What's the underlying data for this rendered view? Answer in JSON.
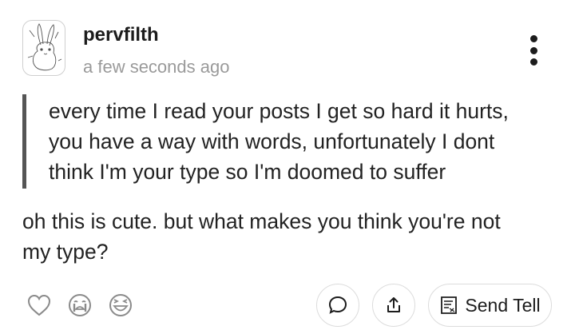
{
  "post": {
    "username": "pervfilth",
    "timestamp": "a few seconds ago",
    "quote_lines": [
      "every time I read your posts I get so hard it hurts,",
      "you have a way with words, unfortunately I dont",
      "think I'm your type so I'm doomed to suffer"
    ],
    "reply_lines": [
      "oh this is cute. but what makes you think you're not",
      "my type?"
    ]
  },
  "actions": {
    "send_tell_label": "Send Tell"
  },
  "icons": {
    "avatar": "bunny-sketch-avatar",
    "more": "vertical-ellipsis-icon",
    "reactions": [
      "heart-icon",
      "crying-face-icon",
      "laughing-face-icon"
    ],
    "comment": "speech-bubble-icon",
    "share": "share-icon",
    "tell": "note-icon"
  }
}
